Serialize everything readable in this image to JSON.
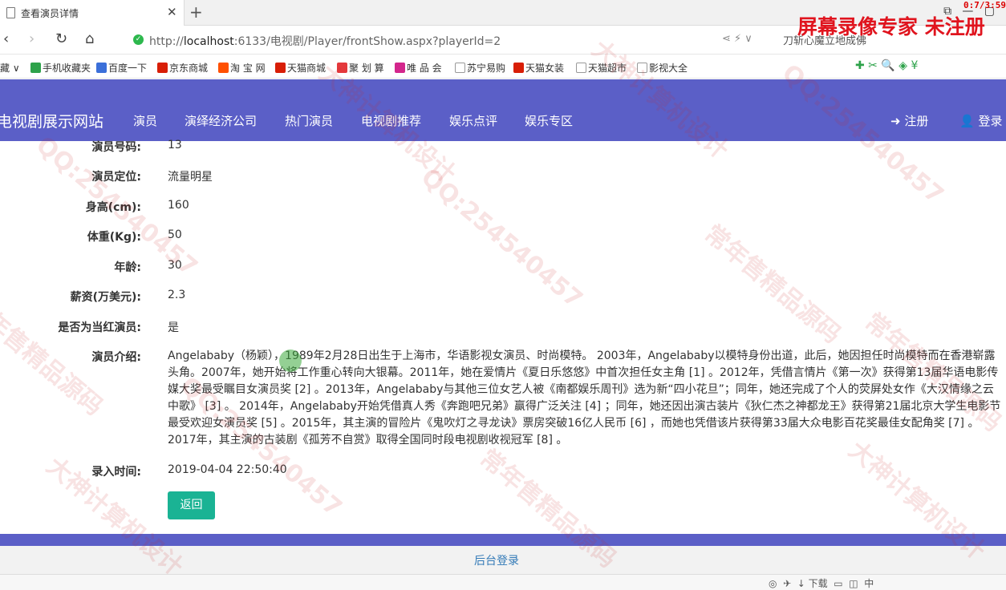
{
  "browser": {
    "tab_title": "查看演员详情",
    "timer": "0:7/3:59",
    "url_prefix": "http://",
    "url_host": "localhost",
    "url_rest": ":6133/电视剧/Player/frontShow.aspx?playerId=2",
    "search_text": "刀斩心魔立地成佛",
    "recorder_watermark": "屏幕录像专家  未注册"
  },
  "bookmarks": [
    {
      "label": "藏 ∨",
      "color": "#ffffff"
    },
    {
      "label": "手机收藏夹",
      "color": "#2da24a"
    },
    {
      "label": "百度一下",
      "color": "#3b6fd9"
    },
    {
      "label": "京东商城",
      "color": "#d81e06"
    },
    {
      "label": "淘 宝 网",
      "color": "#ff5000"
    },
    {
      "label": "天猫商城",
      "color": "#d81e06"
    },
    {
      "label": "聚 划 算",
      "color": "#e4393c"
    },
    {
      "label": "唯 品 会",
      "color": "#d3268c"
    },
    {
      "label": "苏宁易购",
      "color": "#ffffff"
    },
    {
      "label": "天猫女装",
      "color": "#d81e06"
    },
    {
      "label": "天猫超市",
      "color": "#ffffff"
    },
    {
      "label": "影视大全",
      "color": "#ffffff"
    }
  ],
  "site": {
    "brand": "电视剧展示网站",
    "nav": [
      "演员",
      "演绎经济公司",
      "热门演员",
      "电视剧推荐",
      "娱乐点评",
      "娱乐专区"
    ],
    "register": "注册",
    "login": "登录"
  },
  "details": {
    "rows": [
      {
        "label": "演员号码:",
        "value": "13"
      },
      {
        "label": "演员定位:",
        "value": "流量明星"
      },
      {
        "label": "身高(cm):",
        "value": "160"
      },
      {
        "label": "体重(Kg):",
        "value": "50"
      },
      {
        "label": "年龄:",
        "value": "30"
      },
      {
        "label": "薪资(万美元):",
        "value": "2.3"
      },
      {
        "label": "是否为当红演员:",
        "value": "是"
      }
    ],
    "intro_label": "演员介绍:",
    "intro_text": "Angelababy（杨颖），1989年2月28日出生于上海市，华语影视女演员、时尚模特。 2003年，Angelababy以模特身份出道，此后，她因担任时尚模特而在香港崭露头角。2007年，她开始将工作重心转向大银幕。2011年，她在爱情片《夏日乐悠悠》中首次担任女主角 [1] 。2012年，凭借言情片《第一次》获得第13届华语电影传媒大奖最受瞩目女演员奖 [2] 。2013年，Angelababy与其他三位女艺人被《南都娱乐周刊》选为新“四小花旦”；同年，她还完成了个人的荧屏处女作《大汉情缘之云中歌》 [3] 。 2014年，Angelababy开始凭借真人秀《奔跑吧兄弟》赢得广泛关注 [4] ；同年，她还因出演古装片《狄仁杰之神都龙王》获得第21届北京大学生电影节最受欢迎女演员奖 [5] 。2015年，其主演的冒险片《鬼吹灯之寻龙诀》票房突破16亿人民币 [6] ，而她也凭借该片获得第33届大众电影百花奖最佳女配角奖 [7] 。2017年，其主演的古装剧《孤芳不自赏》取得全国同时段电视剧收视冠军 [8] 。",
    "time_label": "录入时间:",
    "time_value": "2019-04-04 22:50:40",
    "back_button": "返回"
  },
  "footer": {
    "admin_link": "后台登录"
  },
  "status": {
    "download": "下载"
  },
  "watermarks": [
    "QQ:254540457",
    "大神计算机设计",
    "常年售精品源码",
    "QQ:254540457",
    "大神计算机设计",
    "常年售精品源码",
    "QQ:254540457",
    "常年售精品源码",
    "大神计算机设计",
    "QQ:254540457",
    "常年售精品源码",
    "大神计算机设计"
  ]
}
